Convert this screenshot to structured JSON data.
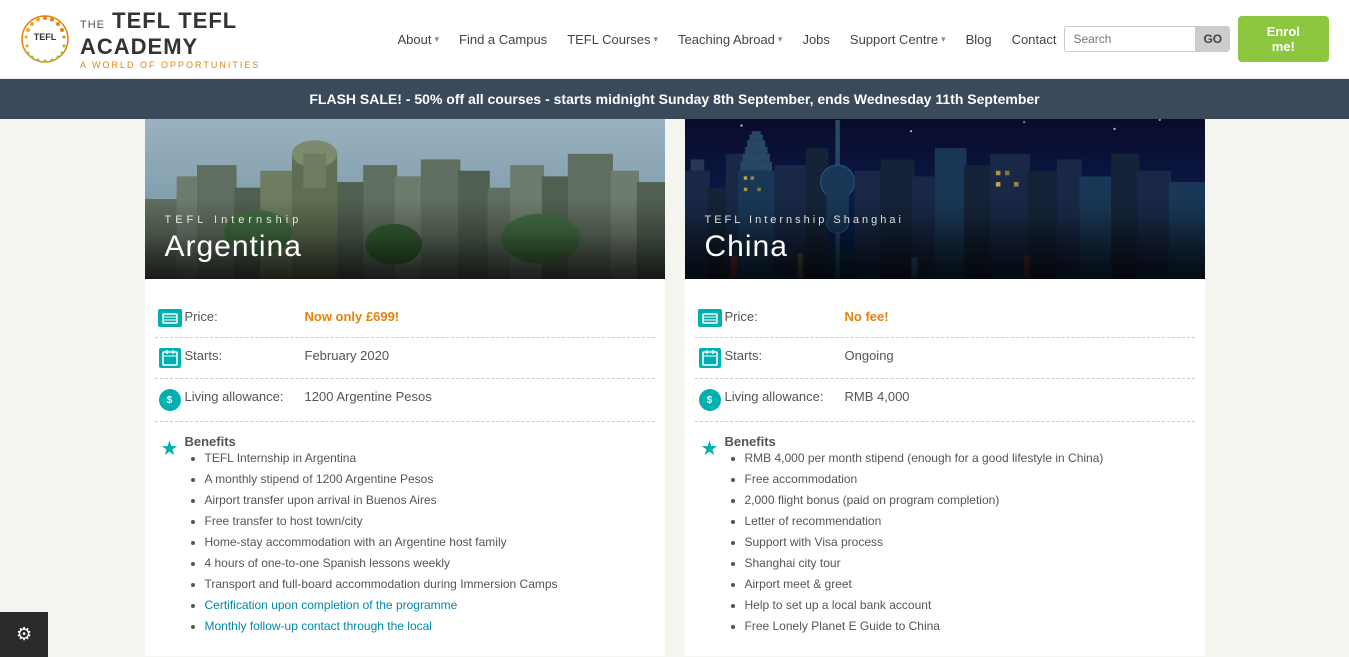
{
  "logo": {
    "the": "THE",
    "tefl": "TEFL",
    "academy": "ACADEMY",
    "tagline": "A WORLD OF OPPORTUNITIES"
  },
  "nav": {
    "items": [
      {
        "label": "About",
        "has_dropdown": true
      },
      {
        "label": "Find a Campus",
        "has_dropdown": false
      },
      {
        "label": "TEFL Courses",
        "has_dropdown": true
      },
      {
        "label": "Teaching Abroad",
        "has_dropdown": true
      },
      {
        "label": "Jobs",
        "has_dropdown": false
      },
      {
        "label": "Support Centre",
        "has_dropdown": true
      },
      {
        "label": "Blog",
        "has_dropdown": false
      },
      {
        "label": "Contact",
        "has_dropdown": false
      }
    ]
  },
  "search": {
    "placeholder": "Search",
    "go_label": "GO"
  },
  "enrol_label": "Enrol me!",
  "flash_banner": "FLASH SALE! - 50% off all courses - starts midnight Sunday 8th September, ends Wednesday 11th September",
  "argentina": {
    "subtitle": "TEFL Internship",
    "title": "Argentina",
    "price_label": "Price:",
    "price_value": "Now only £699!",
    "starts_label": "Starts:",
    "starts_value": "February 2020",
    "allowance_label": "Living allowance:",
    "allowance_value": "1200 Argentine Pesos",
    "benefits_label": "Benefits",
    "benefits": [
      "TEFL Internship in Argentina",
      "A monthly stipend of 1200 Argentine Pesos",
      "Airport transfer upon arrival in Buenos Aires",
      "Free transfer to host town/city",
      "Home-stay accommodation with an Argentine host family",
      "4 hours of one-to-one Spanish lessons weekly",
      "Transport and full-board accommodation during Immersion Camps",
      "Certification upon completion of the programme",
      "Monthly follow-up contact through the local"
    ]
  },
  "china": {
    "subtitle": "TEFL Internship Shanghai",
    "title": "China",
    "price_label": "Price:",
    "price_value": "No fee!",
    "starts_label": "Starts:",
    "starts_value": "Ongoing",
    "allowance_label": "Living allowance:",
    "allowance_value": "RMB 4,000",
    "benefits_label": "Benefits",
    "benefits": [
      "RMB 4,000 per month stipend (enough for a good lifestyle in China)",
      "Free accommodation",
      "2,000 flight bonus (paid on program completion)",
      "Letter of recommendation",
      "Support with Visa process",
      "Shanghai city tour",
      "Airport meet & greet",
      "Help to set up a local bank account",
      "Free Lonely Planet E Guide to China"
    ]
  },
  "cookie_icon": "⚙"
}
